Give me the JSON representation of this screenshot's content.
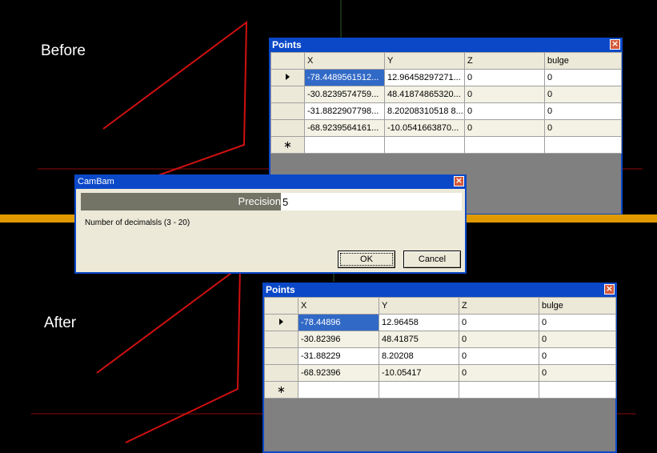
{
  "annotations": {
    "before": "Before",
    "after": "After"
  },
  "points_before": {
    "title": "Points",
    "close": "×",
    "columns": [
      "X",
      "Y",
      "Z",
      "bulge"
    ],
    "rows": [
      [
        "-78.4489561512...",
        "12.96458297271...",
        "0",
        "0"
      ],
      [
        "-30.8239574759...",
        "48.41874865320...",
        "0",
        "0"
      ],
      [
        "-31.8822907798...",
        "8.20208310518 8...",
        "0",
        "0"
      ],
      [
        "-68.9239564161...",
        "-10.0541663870...",
        "0",
        "0"
      ]
    ],
    "new_row_marker": "∗"
  },
  "dialog": {
    "title": "CamBam",
    "close": "×",
    "precision_label": "Precision",
    "precision_value": "5",
    "description": "Number of decimalsls (3 - 20)",
    "ok_label": "OK",
    "cancel_label": "Cancel"
  },
  "points_after": {
    "title": "Points",
    "close": "×",
    "columns": [
      "X",
      "Y",
      "Z",
      "bulge"
    ],
    "rows": [
      [
        "-78.44896",
        "12.96458",
        "0",
        "0"
      ],
      [
        "-30.82396",
        "48.41875",
        "0",
        "0"
      ],
      [
        "-31.88229",
        "8.20208",
        "0",
        "0"
      ],
      [
        "-68.92396",
        "-10.05417",
        "0",
        "0"
      ]
    ],
    "new_row_marker": "∗"
  },
  "colors": {
    "titlebar": "#0a48c8",
    "selection": "#3169c6",
    "orange_bar": "#e09a00",
    "lines": "#d01010"
  }
}
